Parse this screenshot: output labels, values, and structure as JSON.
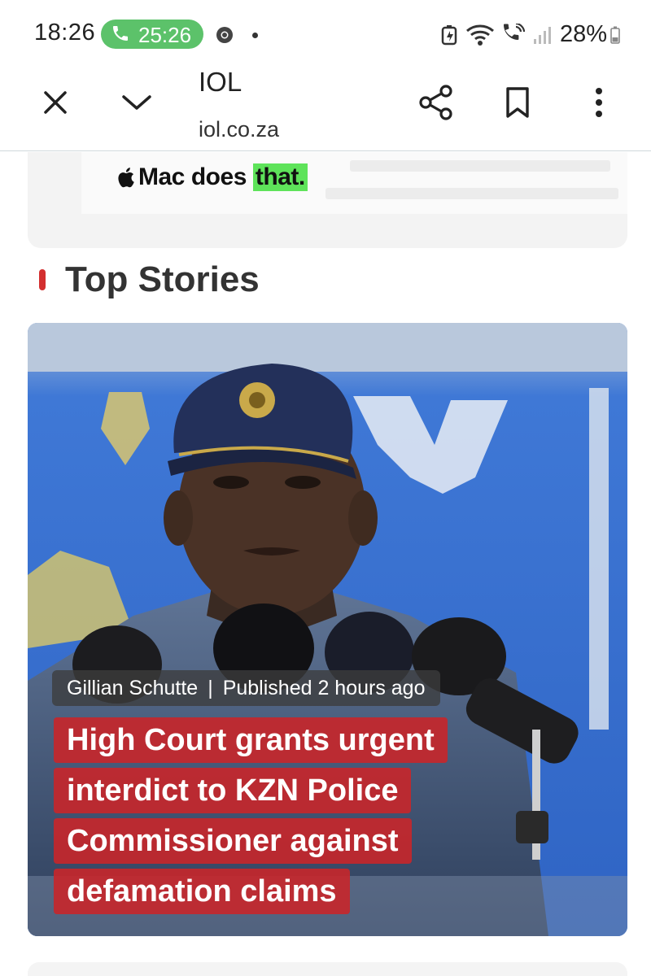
{
  "status_bar": {
    "time": "18:26",
    "call_timer": "25:26",
    "battery": "28%"
  },
  "toolbar": {
    "title": "IOL",
    "url": "iol.co.za"
  },
  "ad": {
    "word1": "Mac",
    "word2": "does",
    "word3": "that."
  },
  "section": {
    "title": "Top Stories"
  },
  "story": {
    "author": "Gillian Schutte",
    "separator": "|",
    "published": "Published 2 hours ago",
    "headline_lines": [
      "High Court grants urgent",
      "interdict to KZN Police",
      "Commissioner against",
      "defamation claims"
    ]
  },
  "colors": {
    "accent_red": "#d32f2f",
    "call_green": "#5cc26a",
    "ad_highlight": "#5ee35a"
  }
}
